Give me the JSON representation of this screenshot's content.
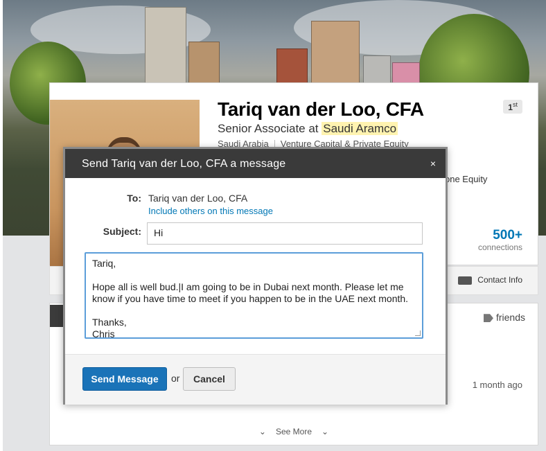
{
  "profile": {
    "name": "Tariq van der Loo, CFA",
    "degree": "1",
    "degree_suffix": "st",
    "headline_prefix": "Senior Associate at ",
    "company": "Saudi Aramco",
    "location": "Saudi Arabia",
    "industry": "Venture Capital & Private Equity",
    "industry_partial": "one Equity",
    "connections_count": "500+",
    "connections_label": "connections",
    "contact_info_label": "Contact Info"
  },
  "activity": {
    "tag_label": "friends",
    "time_ago": "1 month ago",
    "see_more_label": "See More"
  },
  "modal": {
    "title": "Send Tariq van der Loo, CFA a message",
    "close_glyph": "×",
    "to_label": "To:",
    "to_value": "Tariq van der Loo, CFA",
    "include_link": "Include others on this message",
    "subject_label": "Subject:",
    "subject_value": "Hi",
    "body_value": "Tariq,\n\nHope all is well bud.|I am going to be in Dubai next month. Please let me know if you have time to meet if you happen to be in the UAE next month.\n\nThanks,\nChris",
    "send_label": "Send Message",
    "or_label": "or",
    "cancel_label": "Cancel"
  },
  "icons": {
    "close": "close-icon",
    "contact": "contact-card-icon",
    "tag": "tag-icon",
    "chevron": "chevron-down-icon"
  },
  "colors": {
    "link_blue": "#0077b5",
    "send_button": "#1a73b8",
    "modal_header": "#3a3a3a",
    "highlight": "#fff3b0"
  }
}
